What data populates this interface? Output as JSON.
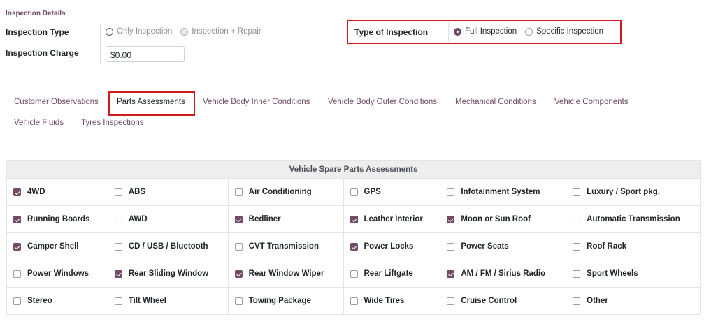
{
  "section": {
    "title": "Inspection Details"
  },
  "inspection_type": {
    "label": "Inspection Type",
    "options": [
      "Only Inspection",
      "Inspection + Repair"
    ]
  },
  "inspection_charge": {
    "label": "Inspection Charge",
    "value": "$0.00"
  },
  "type_of_inspection": {
    "label": "Type of Inspection",
    "options": [
      "Full Inspection",
      "Specific Inspection"
    ],
    "selected": "Full Inspection"
  },
  "tabs": [
    "Customer Observations",
    "Parts Assessments",
    "Vehicle Body Inner Conditions",
    "Vehicle Body Outer Conditions",
    "Mechanical Conditions",
    "Vehicle Components",
    "Vehicle Fluids",
    "Tyres Inspections"
  ],
  "active_tab": "Parts Assessments",
  "parts_table": {
    "title": "Vehicle Spare Parts Assessments",
    "rows": [
      [
        {
          "label": "4WD",
          "checked": true
        },
        {
          "label": "ABS",
          "checked": false
        },
        {
          "label": "Air Conditioning",
          "checked": false
        },
        {
          "label": "GPS",
          "checked": false
        },
        {
          "label": "Infotainment System",
          "checked": false
        },
        {
          "label": "Luxury / Sport pkg.",
          "checked": false
        }
      ],
      [
        {
          "label": "Running Boards",
          "checked": true
        },
        {
          "label": "AWD",
          "checked": false
        },
        {
          "label": "Bedliner",
          "checked": true
        },
        {
          "label": "Leather Interior",
          "checked": true
        },
        {
          "label": "Moon or Sun Roof",
          "checked": true
        },
        {
          "label": "Automatic Transmission",
          "checked": false
        }
      ],
      [
        {
          "label": "Camper Shell",
          "checked": true
        },
        {
          "label": "CD / USB / Bluetooth",
          "checked": false
        },
        {
          "label": "CVT Transmission",
          "checked": false
        },
        {
          "label": "Power Locks",
          "checked": true
        },
        {
          "label": "Power Seats",
          "checked": false
        },
        {
          "label": "Roof Rack",
          "checked": false
        }
      ],
      [
        {
          "label": "Power Windows",
          "checked": false
        },
        {
          "label": "Rear Sliding Window",
          "checked": true
        },
        {
          "label": "Rear Window Wiper",
          "checked": true
        },
        {
          "label": "Rear Liftgate",
          "checked": false
        },
        {
          "label": "AM / FM / Sirius Radio",
          "checked": true
        },
        {
          "label": "Sport Wheels",
          "checked": false
        }
      ],
      [
        {
          "label": "Stereo",
          "checked": false
        },
        {
          "label": "Tilt Wheel",
          "checked": false
        },
        {
          "label": "Towing Package",
          "checked": false
        },
        {
          "label": "Wide Tires",
          "checked": false
        },
        {
          "label": "Cruise Control",
          "checked": false
        },
        {
          "label": "Other",
          "checked": false
        }
      ]
    ]
  },
  "colors": {
    "accent": "#714b67",
    "highlight": "#d01c1c"
  }
}
